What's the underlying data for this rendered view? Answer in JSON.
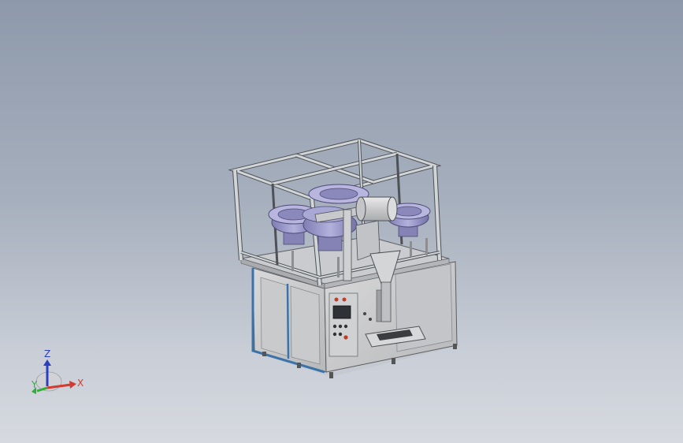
{
  "viewport": {
    "background_top": "#8e99ab",
    "background_bottom": "#d6d9df"
  },
  "model": {
    "frame_color": "#d2d5d8",
    "panel_color": "#c3c4c6",
    "bowl_color": "#9a98c8",
    "base_trim_color": "#3b73a8"
  },
  "triad": {
    "x_label": "X",
    "y_label": "Y",
    "z_label": "Z",
    "x_color": "#d43a2f",
    "y_color": "#2fae35",
    "z_color": "#2b3fbf"
  }
}
